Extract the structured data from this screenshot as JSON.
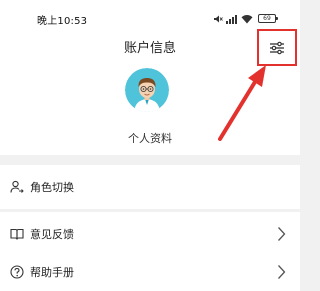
{
  "status_bar": {
    "time": "晚上10:53",
    "battery": "69",
    "icons": [
      "mute-icon",
      "signal-icon",
      "wifi-icon",
      "battery-icon"
    ]
  },
  "header": {
    "title": "账户信息",
    "settings_icon": "sliders-icon"
  },
  "profile": {
    "label": "个人资料"
  },
  "menu": {
    "items": [
      {
        "label": "角色切换",
        "icon": "user-switch-icon",
        "has_chevron": false
      },
      {
        "label": "意见反馈",
        "icon": "book-icon",
        "has_chevron": true
      },
      {
        "label": "帮助手册",
        "icon": "help-circle-icon",
        "has_chevron": true
      }
    ]
  },
  "colors": {
    "accent": "#e3322e",
    "avatar_bg": "#4fc3d9",
    "background": "#f1f1f1"
  }
}
